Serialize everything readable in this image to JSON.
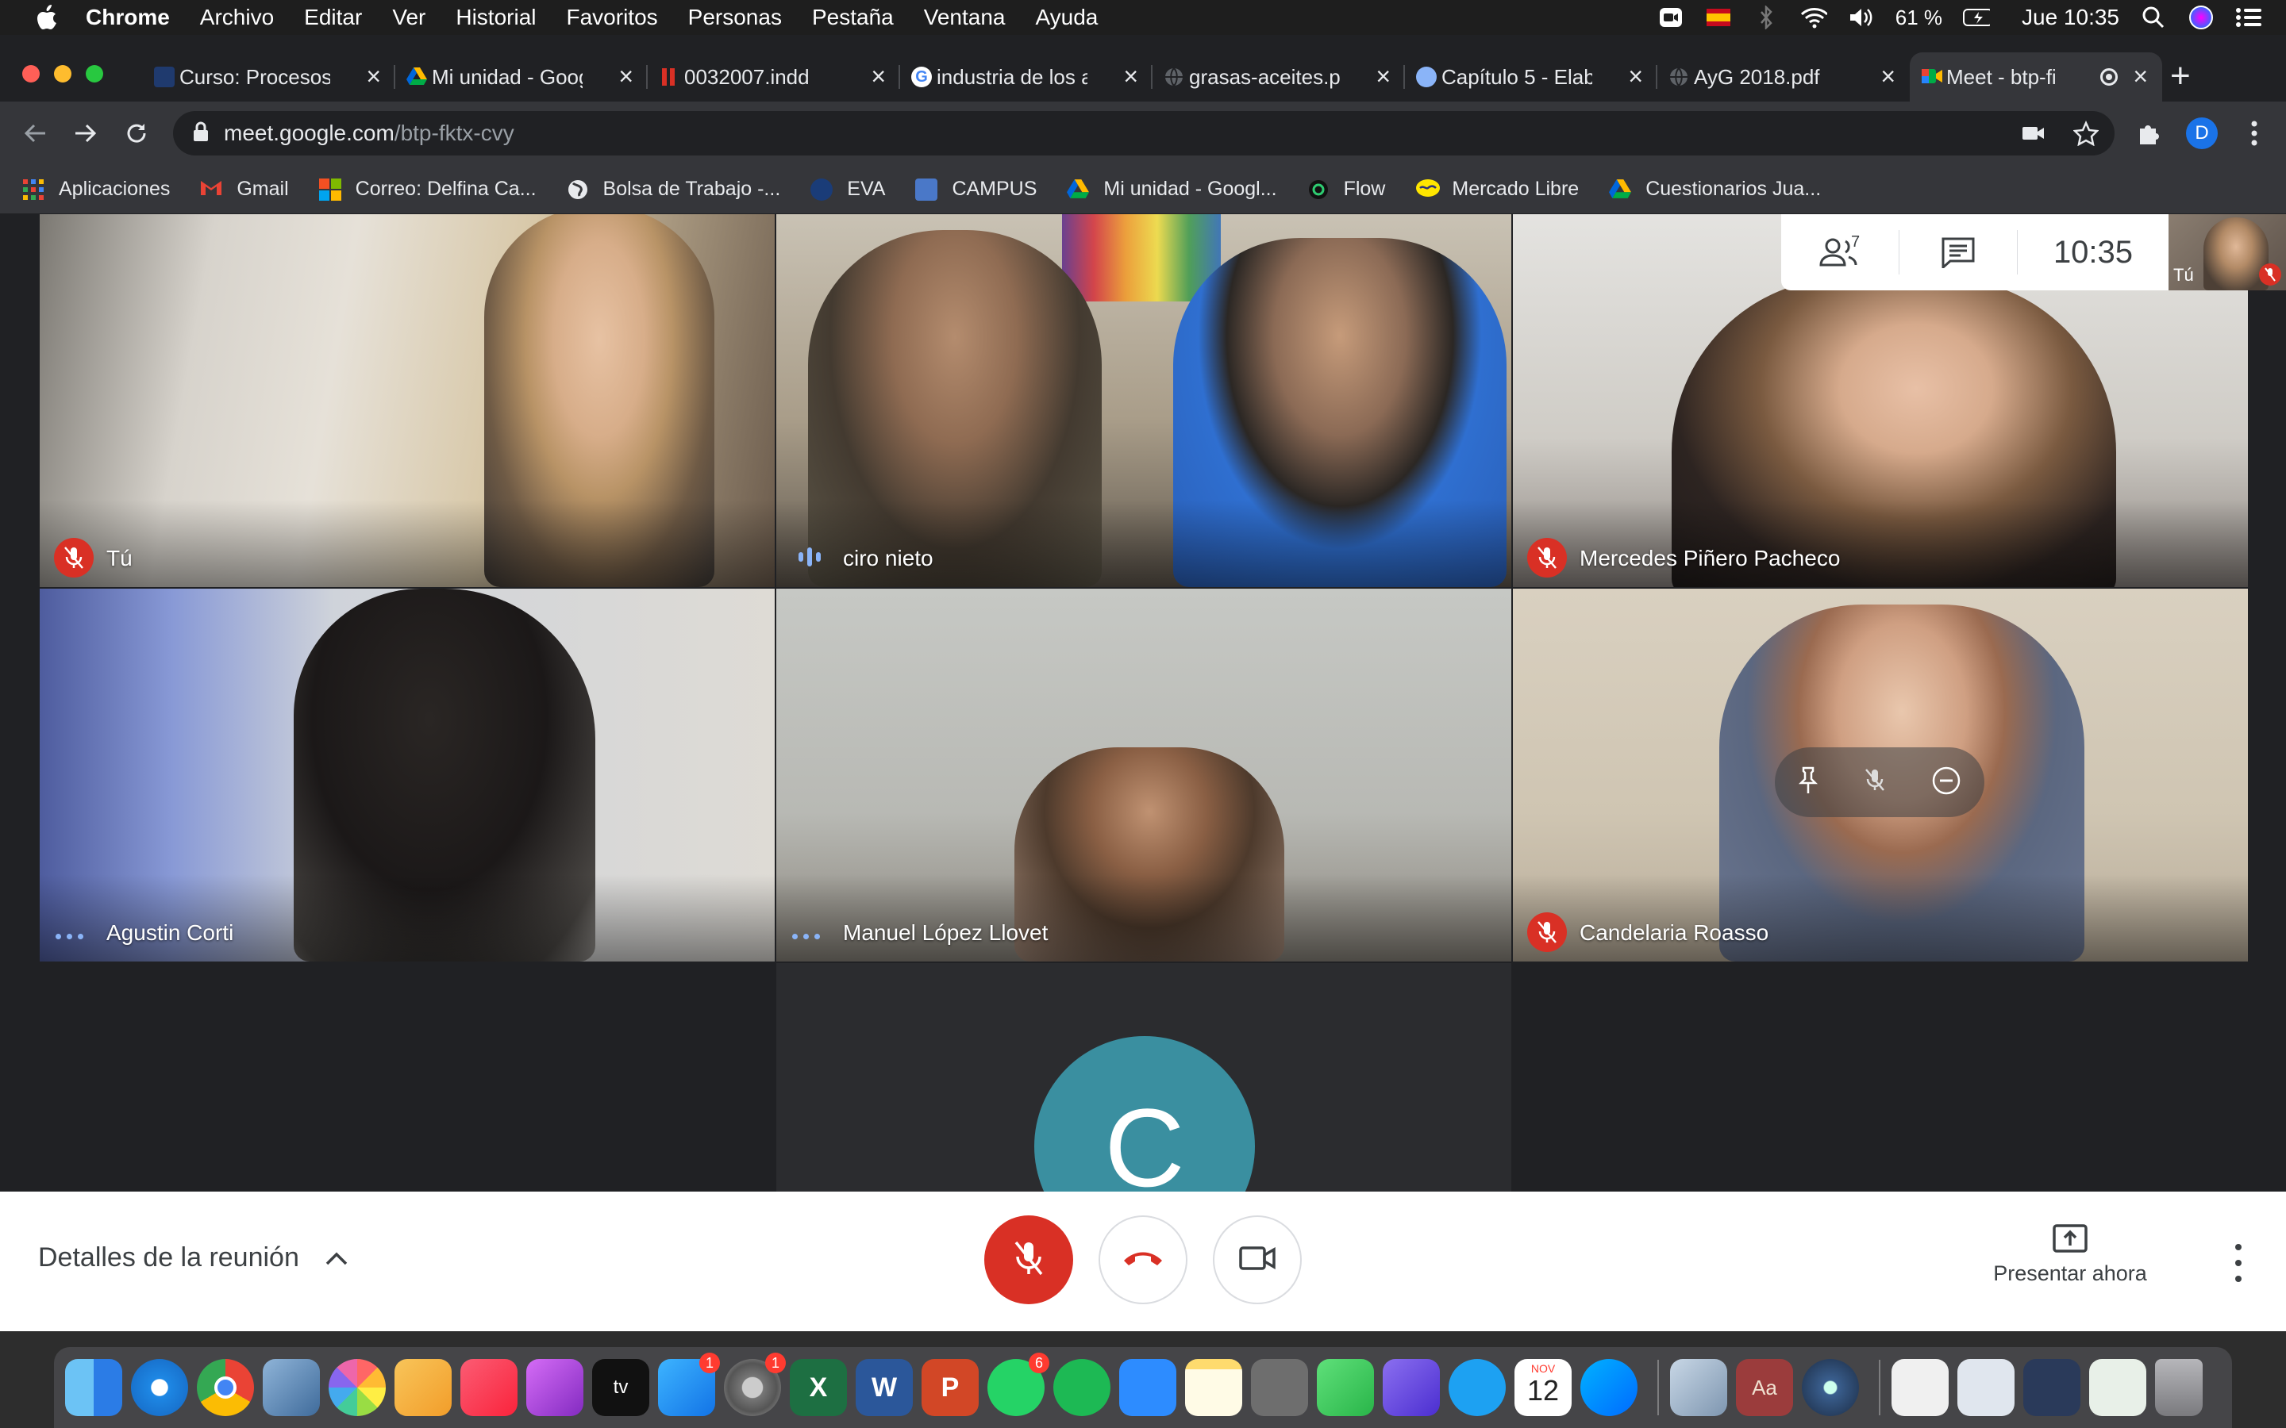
{
  "menubar": {
    "app_name": "Chrome",
    "items": [
      "Archivo",
      "Editar",
      "Ver",
      "Historial",
      "Favoritos",
      "Personas",
      "Pestaña",
      "Ventana",
      "Ayuda"
    ],
    "battery": "61 %",
    "clock": "Jue 10:35"
  },
  "tabs": [
    {
      "label": "Curso: Procesos",
      "color": "#1f3a6e"
    },
    {
      "label": "Mi unidad - Goog",
      "color": "#34a853"
    },
    {
      "label": "0032007.indd",
      "color": "#d93025"
    },
    {
      "label": "industria de los a",
      "color": "#ffffff"
    },
    {
      "label": "grasas-aceites.p",
      "color": "#5f6368"
    },
    {
      "label": "Capítulo 5 - Elab",
      "color": "#8ab4f8"
    },
    {
      "label": "AyG 2018.pdf",
      "color": "#5f6368"
    },
    {
      "label": "Meet - btp-fi",
      "color": "#00ac47"
    }
  ],
  "address": {
    "domain": "meet.google.com",
    "path": "/btp-fktx-cvy"
  },
  "profile_initial": "D",
  "bookmarks": [
    {
      "label": "Aplicaciones",
      "color": "#ea4335"
    },
    {
      "label": "Gmail",
      "color": "#ea4335"
    },
    {
      "label": "Correo: Delfina Ca...",
      "color": "#f25022"
    },
    {
      "label": "Bolsa de Trabajo -...",
      "color": "#e8eaed"
    },
    {
      "label": "EVA",
      "color": "#1a3c78"
    },
    {
      "label": "CAMPUS",
      "color": "#4a78c8"
    },
    {
      "label": "Mi unidad - Googl...",
      "color": "#34a853"
    },
    {
      "label": "Flow",
      "color": "#2ecc71"
    },
    {
      "label": "Mercado Libre",
      "color": "#ffe600"
    },
    {
      "label": "Cuestionarios Jua...",
      "color": "#34a853"
    }
  ],
  "meet": {
    "clock": "10:35",
    "participant_count": "7",
    "self_label": "Tú",
    "participants": [
      {
        "name": "Tú",
        "status": "muted",
        "bg1": "#c9c0b2",
        "bg2": "#6e6357"
      },
      {
        "name": "ciro nieto",
        "status": "speaking",
        "bg1": "#b8a98f",
        "bg2": "#2f5fb0"
      },
      {
        "name": "Mercedes Piñero Pacheco",
        "status": "muted",
        "bg1": "#d8d6d2",
        "bg2": "#3a2e28"
      },
      {
        "name": "Agustin Corti",
        "status": "dots",
        "bg1": "#6a7fc4",
        "bg2": "#1c1a19"
      },
      {
        "name": "Manuel López Llovet",
        "status": "dots",
        "bg1": "#bfc1bd",
        "bg2": "#6b5a4a"
      },
      {
        "name": "Candelaria Roasso",
        "status": "muted",
        "bg1": "#d7cfbf",
        "bg2": "#5f6a80"
      }
    ],
    "pending_avatar_letter": "C",
    "pending_avatar_color": "#3a8fa0"
  },
  "callbar": {
    "details_label": "Detalles de la reunión",
    "present_label": "Presentar ahora",
    "hangup_color": "#d93025"
  },
  "dock": {
    "apps": [
      {
        "name": "finder",
        "color": "#3b8eea"
      },
      {
        "name": "safari",
        "color": "#1e88e5"
      },
      {
        "name": "chrome",
        "color": "#e8eaed"
      },
      {
        "name": "preview",
        "color": "#5b84b1"
      },
      {
        "name": "photos",
        "color": "#f4f4f4"
      },
      {
        "name": "pages",
        "color": "#f5a623"
      },
      {
        "name": "music",
        "color": "#fc3c44"
      },
      {
        "name": "podcasts",
        "color": "#9b4fd0"
      },
      {
        "name": "tv",
        "color": "#111111"
      },
      {
        "name": "app-store",
        "color": "#1e90ff",
        "badge": "1"
      },
      {
        "name": "system-preferences",
        "color": "#8e8e93",
        "badge": "1"
      },
      {
        "name": "excel",
        "color": "#1d6f42"
      },
      {
        "name": "word",
        "color": "#2b579a"
      },
      {
        "name": "powerpoint",
        "color": "#d24726"
      },
      {
        "name": "whatsapp",
        "color": "#25d366",
        "badge": "6"
      },
      {
        "name": "spotify",
        "color": "#1db954"
      },
      {
        "name": "zoom",
        "color": "#2d8cff"
      },
      {
        "name": "notes",
        "color": "#fedb6e"
      },
      {
        "name": "calculator",
        "color": "#6e6e6e"
      },
      {
        "name": "facetime",
        "color": "#32c75a"
      },
      {
        "name": "imovie",
        "color": "#6c4fe0"
      },
      {
        "name": "twitter",
        "color": "#1da1f2"
      },
      {
        "name": "calendar",
        "color": "#ffffff"
      },
      {
        "name": "messenger",
        "color": "#0a7cff"
      },
      {
        "name": "image-capture",
        "color": "#9fb6cf"
      },
      {
        "name": "dictionary",
        "color": "#9b3c3c"
      },
      {
        "name": "quicktime",
        "color": "#3a5f8f"
      },
      {
        "name": "doc-preview-1",
        "color": "#f0f0f0"
      },
      {
        "name": "doc-preview-2",
        "color": "#e0e6ee"
      },
      {
        "name": "doc-preview-3",
        "color": "#2a3a5a"
      },
      {
        "name": "doc-preview-4",
        "color": "#e8f0e8"
      },
      {
        "name": "trash",
        "color": "#8a8a8e"
      }
    ],
    "calendar_month": "NOV",
    "calendar_day": "12"
  }
}
